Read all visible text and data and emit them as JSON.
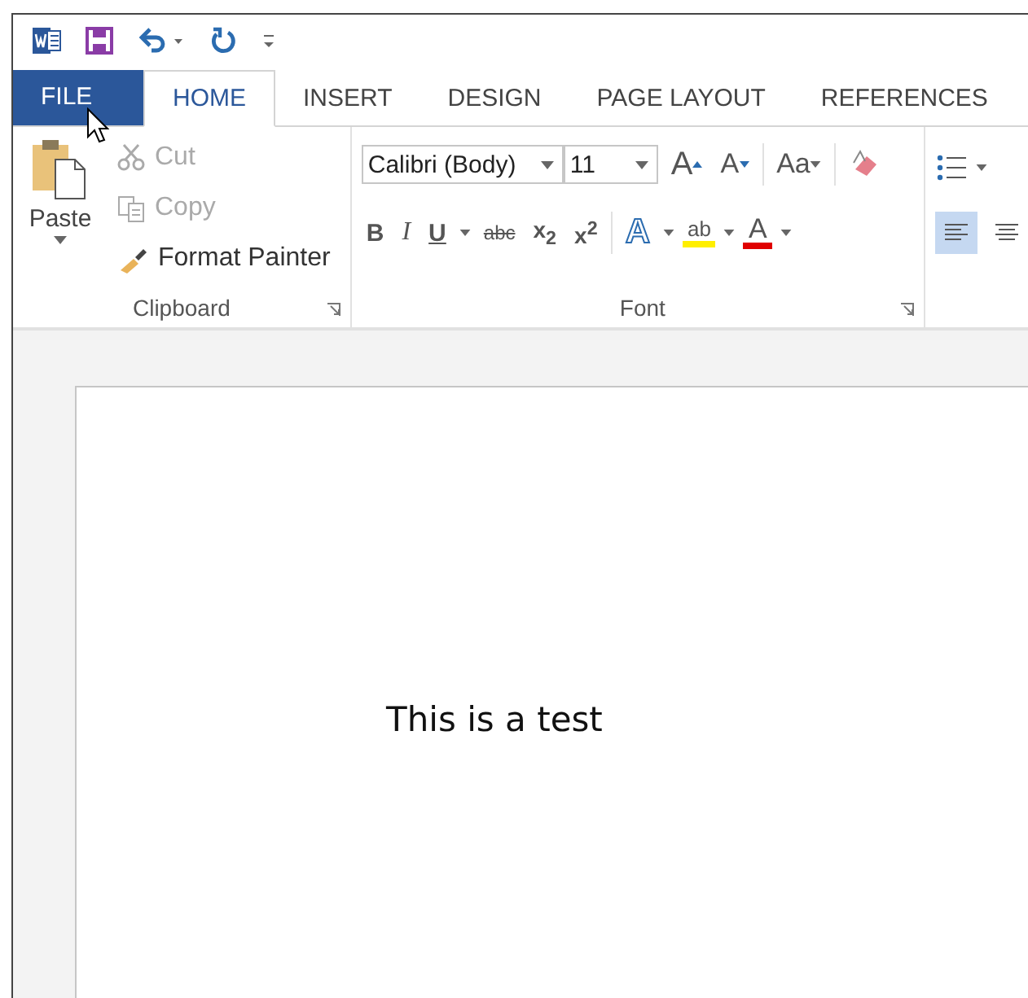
{
  "tabs": [
    {
      "label": "FILE",
      "kind": "file",
      "selected": false
    },
    {
      "label": "HOME",
      "kind": "tab",
      "selected": true
    },
    {
      "label": "INSERT",
      "kind": "tab",
      "selected": false
    },
    {
      "label": "DESIGN",
      "kind": "tab",
      "selected": false
    },
    {
      "label": "PAGE LAYOUT",
      "kind": "tab",
      "selected": false
    },
    {
      "label": "REFERENCES",
      "kind": "tab",
      "selected": false
    }
  ],
  "clipboard": {
    "paste": "Paste",
    "items": [
      {
        "label": "Cut",
        "disabled": true
      },
      {
        "label": "Copy",
        "disabled": true
      },
      {
        "label": "Format Painter",
        "disabled": false
      }
    ],
    "group_label": "Clipboard"
  },
  "font": {
    "font_name": "Calibri (Body)",
    "font_size": "11",
    "grow": "A",
    "shrink": "A",
    "change_case": "Aa",
    "bold": "B",
    "italic": "I",
    "underline": "U",
    "strikethrough": "abc",
    "subscript": "x$_{2}$",
    "superscript": "x$^{2}$",
    "text_effects": "A",
    "highlight": "ab",
    "font_color": "A",
    "group_label": "Font"
  },
  "paragraph": {
    "align": [
      {
        "kind": "left",
        "selected": true
      },
      {
        "kind": "center",
        "selected": false
      }
    ]
  },
  "document": {
    "text": "This is a test"
  }
}
